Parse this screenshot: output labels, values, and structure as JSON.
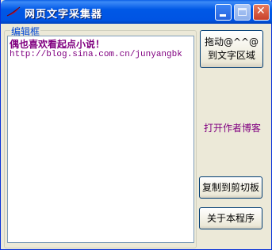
{
  "window": {
    "title": "网页文字采集器",
    "colors": {
      "titlebar": "#0054e3",
      "body": "#ece9d8",
      "accent_text": "#800080",
      "group_label": "#0046d5"
    }
  },
  "icons": {
    "app": "feather-quill-icon",
    "minimize": "minimize-icon",
    "maximize": "maximize-icon",
    "close": "close-icon"
  },
  "editor": {
    "group_label": "编辑框",
    "lines": [
      "偶也喜欢看起点小说！",
      "http://blog.sina.com.cn/junyangbk"
    ]
  },
  "buttons": {
    "drag": "拖动@^^@到文字区域",
    "open_blog": "打开作者博客",
    "copy": "复制到剪切板",
    "about": "关于本程序"
  }
}
